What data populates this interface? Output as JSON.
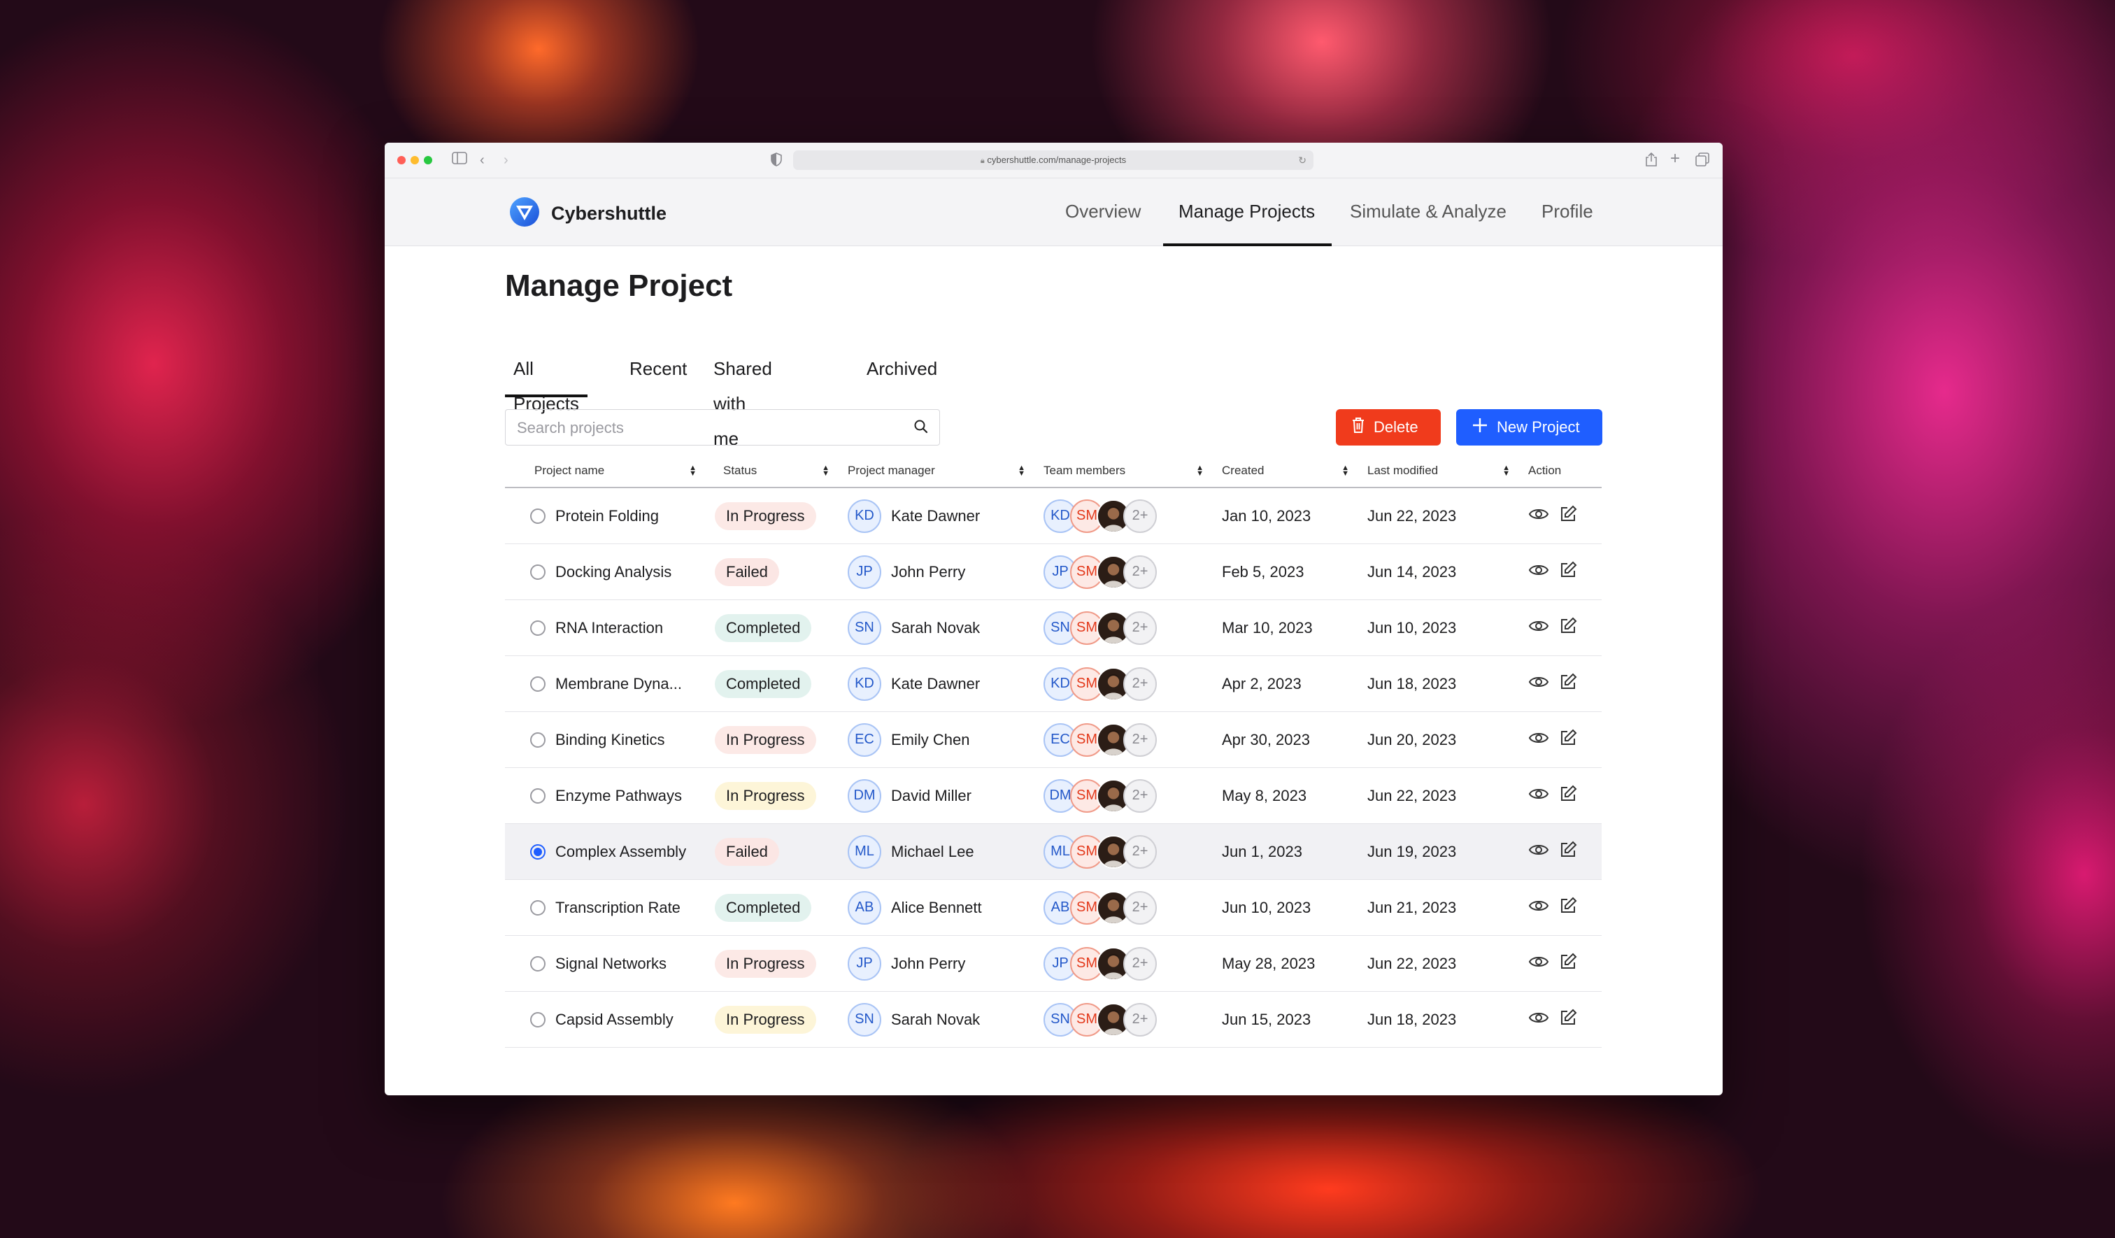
{
  "browser": {
    "url": "cybershuttle.com/manage-projects",
    "colors": {
      "close": "#ff5f57",
      "minimize": "#febc2e",
      "maximize": "#28c840"
    }
  },
  "nav": {
    "brand": "Cybershuttle",
    "links": [
      "Overview",
      "Manage Projects",
      "Simulate & Analyze",
      "Profile"
    ],
    "active": "Manage Projects"
  },
  "page": {
    "title": "Manage Project",
    "tabs": [
      "All Projects",
      "Recent",
      "Shared with me",
      "Archived"
    ],
    "active_tab": "All Projects",
    "search_placeholder": "Search projects",
    "delete_label": "Delete",
    "new_label": "New Project",
    "colors": {
      "primary": "#1f5eff",
      "danger": "#f03b1c"
    }
  },
  "table": {
    "headers": [
      "Project name",
      "Status",
      "Project manager",
      "Team members",
      "Created",
      "Last modified",
      "Action"
    ],
    "rows": [
      {
        "name": "Protein Folding",
        "status": "In Progress",
        "manager_initials": "KD",
        "manager": "Kate Dawner",
        "team_initials": "KD",
        "team_second": "SM",
        "team_more": "2+",
        "created": "Jan 10, 2023",
        "modified": "Jun 22, 2023"
      },
      {
        "name": "Docking Analysis",
        "status": "Failed",
        "manager_initials": "JP",
        "manager": "John Perry",
        "team_initials": "JP",
        "team_second": "SM",
        "team_more": "2+",
        "created": "Feb 5, 2023",
        "modified": "Jun 14, 2023"
      },
      {
        "name": "RNA Interaction",
        "status": "Completed",
        "manager_initials": "SN",
        "manager": "Sarah Novak",
        "team_initials": "SN",
        "team_second": "SM",
        "team_more": "2+",
        "created": "Mar 10, 2023",
        "modified": "Jun 10, 2023"
      },
      {
        "name": "Membrane Dyna...",
        "status": "Completed",
        "manager_initials": "KD",
        "manager": "Kate Dawner",
        "team_initials": "KD",
        "team_second": "SM",
        "team_more": "2+",
        "created": "Apr 2, 2023",
        "modified": "Jun 18, 2023"
      },
      {
        "name": "Binding Kinetics",
        "status": "In Progress",
        "manager_initials": "EC",
        "manager": "Emily Chen",
        "team_initials": "EC",
        "team_second": "SM",
        "team_more": "2+",
        "created": "Apr 30, 2023",
        "modified": "Jun 20, 2023"
      },
      {
        "name": "Enzyme Pathways",
        "status": "In Progress",
        "manager_initials": "DM",
        "manager": "David Miller",
        "team_initials": "DM",
        "team_second": "SM",
        "team_more": "2+",
        "created": "May 8, 2023",
        "modified": "Jun 22, 2023"
      },
      {
        "name": "Complex Assembly",
        "status": "Failed",
        "manager_initials": "ML",
        "manager": "Michael Lee",
        "team_initials": "ML",
        "team_second": "SM",
        "team_more": "2+",
        "created": "Jun 1, 2023",
        "modified": "Jun 19, 2023",
        "selected": true
      },
      {
        "name": "Transcription Rate",
        "status": "Completed",
        "manager_initials": "AB",
        "manager": "Alice Bennett",
        "team_initials": "AB",
        "team_second": "SM",
        "team_more": "2+",
        "created": "Jun 10, 2023",
        "modified": "Jun 21, 2023"
      },
      {
        "name": "Signal Networks",
        "status": "In Progress",
        "manager_initials": "JP",
        "manager": "John Perry",
        "team_initials": "JP",
        "team_second": "SM",
        "team_more": "2+",
        "created": "May 28, 2023",
        "modified": "Jun 22, 2023"
      },
      {
        "name": "Capsid Assembly",
        "status": "In Progress",
        "manager_initials": "SN",
        "manager": "Sarah Novak",
        "team_initials": "SN",
        "team_second": "SM",
        "team_more": "2+",
        "created": "Jun 15, 2023",
        "modified": "Jun 18, 2023"
      }
    ]
  }
}
